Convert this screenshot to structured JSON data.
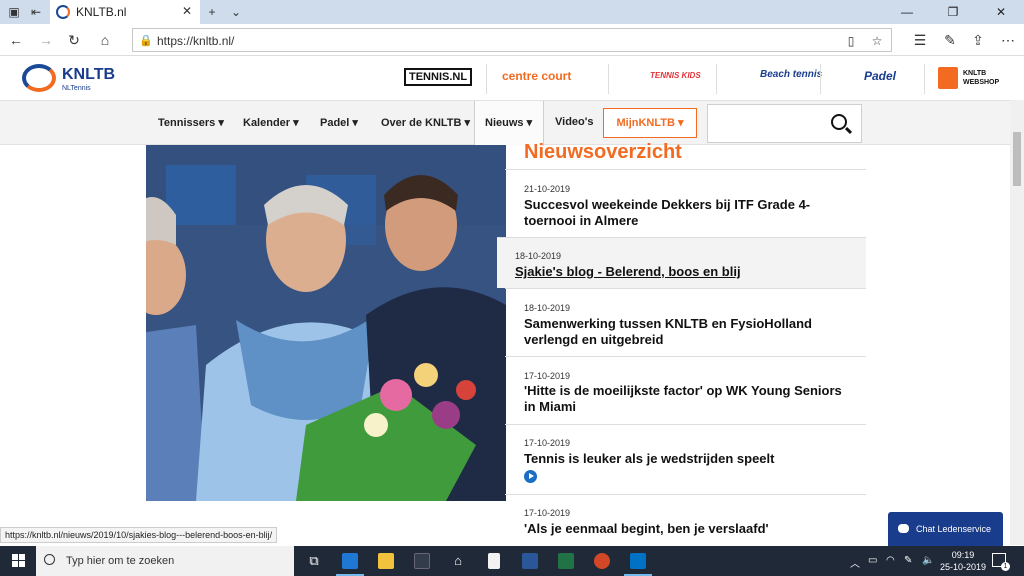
{
  "browser": {
    "tab_title": "KNLTB.nl",
    "url": "https://knltb.nl/"
  },
  "site": {
    "logo": "KNLTB",
    "logo_sub": "NLTennis",
    "partners": [
      "TENNIS.NL",
      "centre court",
      "TENNIS KIDS",
      "Beach tennis",
      "Padel",
      "KNLTB WEBSHOP"
    ]
  },
  "nav": {
    "items": [
      "Tennissers",
      "Kalender",
      "Padel",
      "Over de KNLTB",
      "Nieuws",
      "Video's"
    ],
    "mijn": "MijnKNLTB",
    "search_placeholder": ""
  },
  "news": {
    "title": "Nieuwsoverzicht",
    "items": [
      {
        "date": "21-10-2019",
        "headline": "Succesvol weekeinde Dekkers bij ITF Grade 4-toernooi in Almere"
      },
      {
        "date": "18-10-2019",
        "headline": "Sjakie's blog - Belerend, boos en blij"
      },
      {
        "date": "18-10-2019",
        "headline": "Samenwerking tussen KNLTB en FysioHolland verlengd en uitgebreid"
      },
      {
        "date": "17-10-2019",
        "headline": "'Hitte is de moeilijkste factor' op WK Young Seniors in Miami"
      },
      {
        "date": "17-10-2019",
        "headline": "Tennis is leuker als je wedstrijden speelt"
      },
      {
        "date": "17-10-2019",
        "headline": "'Als je eenmaal begint, ben je verslaafd'"
      }
    ]
  },
  "status_url": "https://knltb.nl/nieuws/2019/10/sjakies-blog---belerend-boos-en-blij/",
  "chat": "Chat Ledenservice",
  "taskbar": {
    "search_placeholder": "Typ hier om te zoeken",
    "time": "09:19",
    "date": "25-10-2019",
    "notification_count": "1"
  },
  "colors": {
    "accent": "#f26b21",
    "brand": "#1a3c8c"
  }
}
